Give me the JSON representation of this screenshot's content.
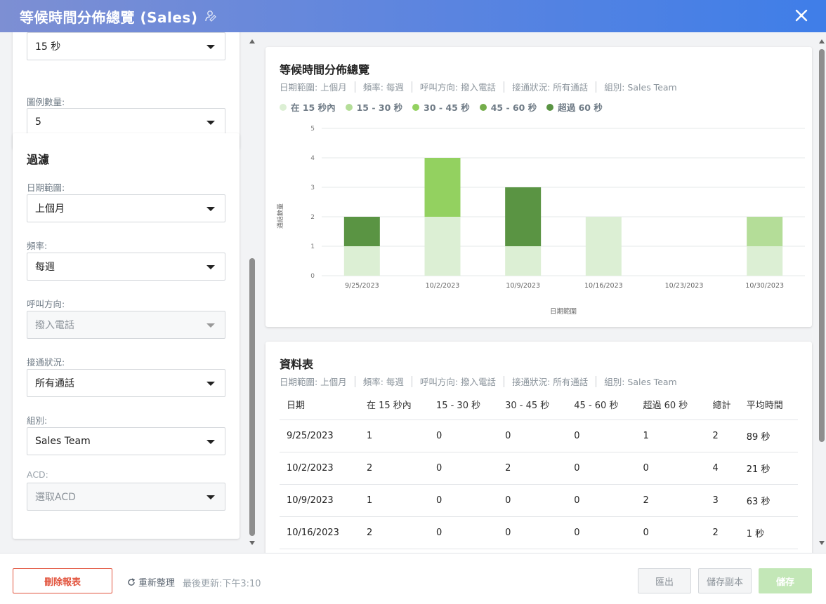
{
  "window": {
    "title": "等候時間分佈總覽 (Sales)"
  },
  "settings": {
    "interval_value": "15 秒",
    "legend_count_label": "圖例數量:",
    "legend_count_value": "5"
  },
  "filters": {
    "title": "過濾",
    "date_range_label": "日期範圍:",
    "date_range_value": "上個月",
    "frequency_label": "頻率:",
    "frequency_value": "每週",
    "direction_label": "呼叫方向:",
    "direction_value": "撥入電話",
    "status_label": "接通狀況:",
    "status_value": "所有通話",
    "group_label": "組別:",
    "group_value": "Sales Team",
    "acd_label": "ACD:",
    "acd_placeholder": "選取ACD"
  },
  "summary_tags": [
    "日期範圍: 上個月",
    "頻率: 每週",
    "呼叫方向: 撥入電話",
    "接通狀況: 所有通話",
    "組別: Sales Team"
  ],
  "chart_card": {
    "title": "等候時間分佈總覽"
  },
  "chart_data": {
    "type": "bar",
    "stacked": true,
    "title": "等候時間分佈總覽",
    "xlabel": "日期範圍",
    "ylabel": "通話數量",
    "ylim": [
      0,
      5
    ],
    "yticks": [
      0,
      1,
      2,
      3,
      4,
      5
    ],
    "grid": true,
    "legend_position": "top-left",
    "categories": [
      "9/25/2023",
      "10/2/2023",
      "10/9/2023",
      "10/16/2023",
      "10/23/2023",
      "10/30/2023"
    ],
    "series": [
      {
        "name": "在 15 秒內",
        "color": "#dcefd4",
        "values": [
          1,
          2,
          1,
          2,
          0,
          1
        ]
      },
      {
        "name": "15 - 30 秒",
        "color": "#b4dd98",
        "values": [
          0,
          0,
          0,
          0,
          0,
          1
        ]
      },
      {
        "name": "30 - 45 秒",
        "color": "#93d160",
        "values": [
          0,
          2,
          0,
          0,
          0,
          0
        ]
      },
      {
        "name": "45 - 60 秒",
        "color": "#74ad4b",
        "values": [
          0,
          0,
          0,
          0,
          0,
          0
        ]
      },
      {
        "name": "超過 60 秒",
        "color": "#5a9443",
        "values": [
          1,
          0,
          2,
          0,
          0,
          0
        ]
      }
    ]
  },
  "table_card": {
    "title": "資料表",
    "columns": [
      "日期",
      "在 15 秒內",
      "15 - 30 秒",
      "30 - 45 秒",
      "45 - 60 秒",
      "超過 60 秒",
      "總計",
      "平均時間"
    ],
    "rows": [
      [
        "9/25/2023",
        "1",
        "0",
        "0",
        "0",
        "1",
        "2",
        "89 秒"
      ],
      [
        "10/2/2023",
        "2",
        "0",
        "2",
        "0",
        "0",
        "4",
        "21 秒"
      ],
      [
        "10/9/2023",
        "1",
        "0",
        "0",
        "0",
        "2",
        "3",
        "63 秒"
      ],
      [
        "10/16/2023",
        "2",
        "0",
        "0",
        "0",
        "0",
        "2",
        "1 秒"
      ]
    ]
  },
  "footer": {
    "delete_label": "刪除報表",
    "refresh_label": "重新整理",
    "last_updated": "最後更新:下午3:10",
    "export_label": "匯出",
    "save_copy_label": "儲存副本",
    "save_label": "儲存"
  }
}
